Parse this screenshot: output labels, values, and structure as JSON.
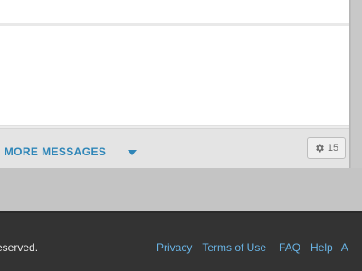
{
  "messages_panel": {
    "more_messages_label": "MORE MESSAGES",
    "partial_prefix": "/",
    "caret_icon": "caret-down-icon",
    "settings_badge": {
      "icon": "gear-icon",
      "count": "15"
    }
  },
  "footer": {
    "copyright_fragment": "eserved.",
    "links": [
      {
        "label": "Privacy"
      },
      {
        "label": "Terms of Use"
      },
      {
        "label": "FAQ"
      },
      {
        "label": "Help"
      },
      {
        "label": "A"
      }
    ]
  },
  "colors": {
    "link_blue": "#2f86b8",
    "footer_link_blue": "#69b3e4",
    "footer_bg": "#333333",
    "page_bg": "#c8c8c8",
    "card_bg": "#ffffff",
    "card_footer_bg": "#e4e4e4"
  }
}
